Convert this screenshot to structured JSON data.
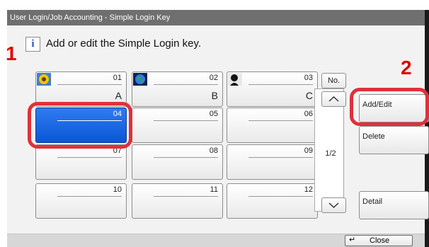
{
  "window": {
    "title": "User Login/Job Accounting - Simple Login Key"
  },
  "message": {
    "icon": "info-icon",
    "text": "Add or edit the Simple Login key."
  },
  "steps": {
    "first": "1",
    "second": "2"
  },
  "keys": [
    {
      "number": "01",
      "name": "A",
      "image": "sunflower-photo"
    },
    {
      "number": "02",
      "name": "B",
      "image": "globe-photo"
    },
    {
      "number": "03",
      "name": "C",
      "image": "silhouette-photo"
    },
    {
      "number": "04",
      "name": "",
      "selected": true
    },
    {
      "number": "05",
      "name": ""
    },
    {
      "number": "06",
      "name": ""
    },
    {
      "number": "07",
      "name": ""
    },
    {
      "number": "08",
      "name": ""
    },
    {
      "number": "09",
      "name": ""
    },
    {
      "number": "10",
      "name": ""
    },
    {
      "number": "11",
      "name": ""
    },
    {
      "number": "12",
      "name": ""
    }
  ],
  "nav": {
    "no_label": "No.",
    "page": "1/2",
    "up_icon": "chevron-up-icon",
    "down_icon": "chevron-down-icon"
  },
  "side_buttons": {
    "add_edit": "Add/Edit",
    "delete": "Delete",
    "detail": "Detail"
  },
  "footer": {
    "close": "Close",
    "close_icon": "return-arrow-icon"
  },
  "colors": {
    "selected": "#0a57d6",
    "highlight_ring": "#e0303a",
    "titlebar": "#6f6f6f"
  }
}
